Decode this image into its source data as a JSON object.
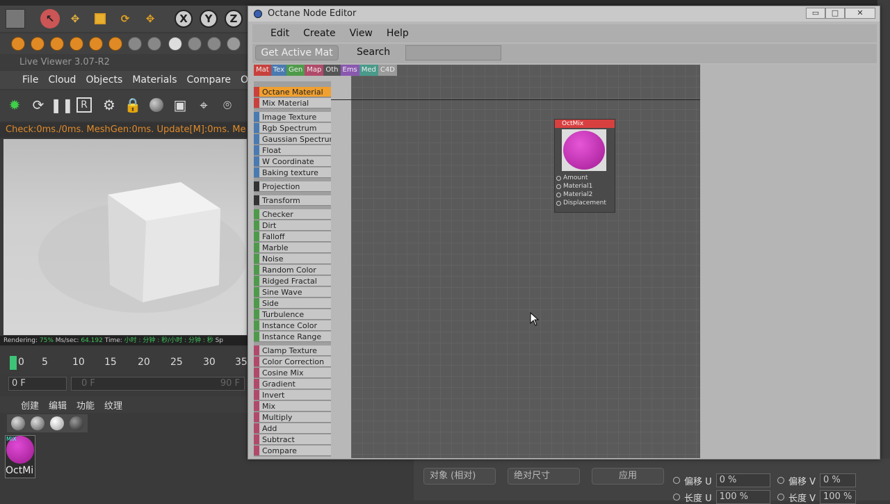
{
  "c4d": {
    "axis_buttons": [
      "X",
      "Y",
      "Z"
    ],
    "live_viewer_title": "Live Viewer 3.07-R2",
    "menu": [
      "File",
      "Cloud",
      "Objects",
      "Materials",
      "Compare",
      "Op"
    ],
    "status": "Check:0ms./0ms. MeshGen:0ms. Update[M]:0ms. Me",
    "render": {
      "label": "Rendering:",
      "pct": "75%",
      "ms_label": "Ms/sec:",
      "ms": "64.192",
      "time_label": "Time:",
      "time": "小时 : 分钟 : 秒/小时 : 分钟 : 秒",
      "extra": "Sp"
    },
    "timeline": [
      "0",
      "5",
      "10",
      "15",
      "20",
      "25",
      "30",
      "35"
    ],
    "frame_current": "0 F",
    "frame_start": "0 F",
    "frame_end": "90 F",
    "mat_menu": [
      "创建",
      "编辑",
      "功能",
      "纹理"
    ],
    "material_name": "OctMi",
    "material_tag": "MIX",
    "attr": {
      "combo1": "对象 (相对)",
      "combo2": "绝对尺寸",
      "apply": "应用",
      "offset_u": "偏移 U",
      "offset_u_val": "0 %",
      "offset_v": "偏移 V",
      "offset_v_val": "0 %",
      "len_u": "长度 U",
      "len_u_val": "100 %",
      "len_v": "长度 V",
      "len_v_val": "100 %"
    }
  },
  "octane": {
    "title": "Octane Node Editor",
    "menu": [
      "Edit",
      "Create",
      "View",
      "Help"
    ],
    "get_active_mat": "Get Active Mat",
    "search_label": "Search",
    "search_value": "",
    "tabs": [
      {
        "label": "Mat",
        "color": "#c8413c"
      },
      {
        "label": "Tex",
        "color": "#4a7ab0"
      },
      {
        "label": "Gen",
        "color": "#4e9a4a"
      },
      {
        "label": "Map",
        "color": "#b04a6a"
      },
      {
        "label": "Oth",
        "color": "#555555"
      },
      {
        "label": "Ems",
        "color": "#8a58b0"
      },
      {
        "label": "Med",
        "color": "#4a9a8a"
      },
      {
        "label": "C4D",
        "color": "#9a9a9a"
      }
    ],
    "nodes": [
      {
        "label": "Octane Material",
        "color": "#c8413c",
        "selected": true
      },
      {
        "label": "Mix Material",
        "color": "#c8413c"
      },
      {
        "label": "Image Texture",
        "color": "#4a7ab0"
      },
      {
        "label": "Rgb Spectrum",
        "color": "#4a7ab0"
      },
      {
        "label": "Gaussian Spectrum",
        "color": "#4a7ab0"
      },
      {
        "label": "Float",
        "color": "#4a7ab0"
      },
      {
        "label": "W Coordinate",
        "color": "#4a7ab0"
      },
      {
        "label": "Baking texture",
        "color": "#4a7ab0"
      },
      {
        "label": "Projection",
        "color": "#333333"
      },
      {
        "label": "Transform",
        "color": "#333333"
      },
      {
        "label": "Checker",
        "color": "#4e9a4a"
      },
      {
        "label": "Dirt",
        "color": "#4e9a4a"
      },
      {
        "label": "Falloff",
        "color": "#4e9a4a"
      },
      {
        "label": "Marble",
        "color": "#4e9a4a"
      },
      {
        "label": "Noise",
        "color": "#4e9a4a"
      },
      {
        "label": "Random Color",
        "color": "#4e9a4a"
      },
      {
        "label": "Ridged Fractal",
        "color": "#4e9a4a"
      },
      {
        "label": "Sine Wave",
        "color": "#4e9a4a"
      },
      {
        "label": "Side",
        "color": "#4e9a4a"
      },
      {
        "label": "Turbulence",
        "color": "#4e9a4a"
      },
      {
        "label": "Instance Color",
        "color": "#4e9a4a"
      },
      {
        "label": "Instance Range",
        "color": "#4e9a4a"
      },
      {
        "label": "Clamp Texture",
        "color": "#b04a6a"
      },
      {
        "label": "Color Correction",
        "color": "#b04a6a"
      },
      {
        "label": "Cosine Mix",
        "color": "#b04a6a"
      },
      {
        "label": "Gradient",
        "color": "#b04a6a"
      },
      {
        "label": "Invert",
        "color": "#b04a6a"
      },
      {
        "label": "Mix",
        "color": "#b04a6a"
      },
      {
        "label": "Multiply",
        "color": "#b04a6a"
      },
      {
        "label": "Add",
        "color": "#b04a6a"
      },
      {
        "label": "Subtract",
        "color": "#b04a6a"
      },
      {
        "label": "Compare",
        "color": "#b04a6a"
      }
    ],
    "graph_node": {
      "title": "OctMix",
      "pins": [
        "Amount",
        "Material1",
        "Material2",
        "Displacement"
      ]
    }
  }
}
